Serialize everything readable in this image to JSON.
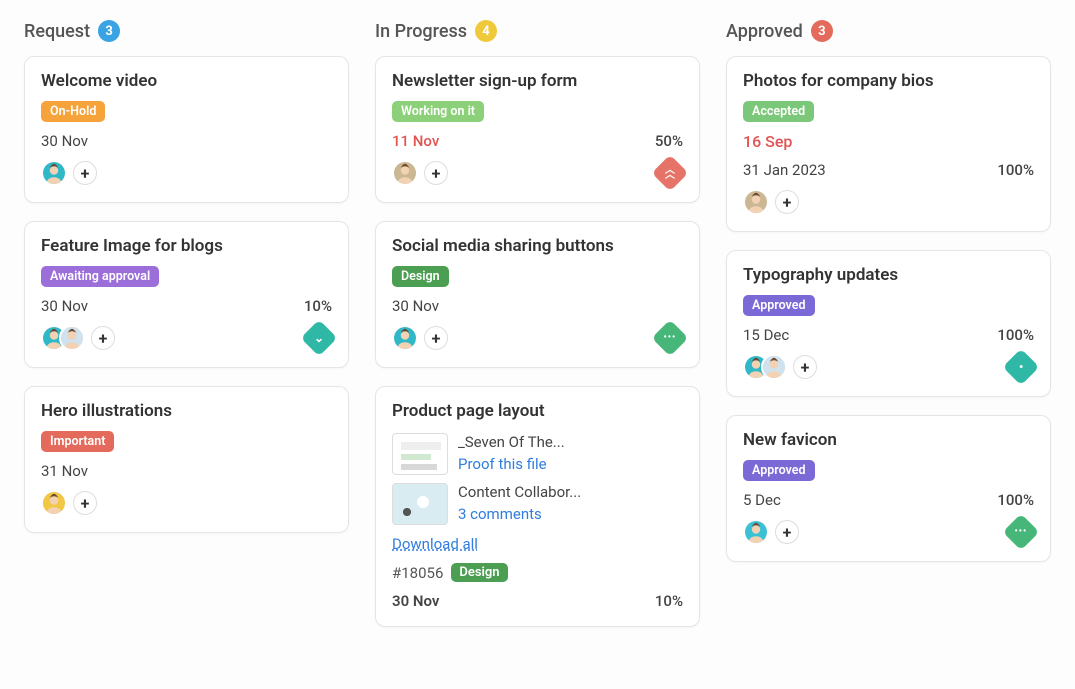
{
  "columns": [
    {
      "title": "Request",
      "count": "3",
      "count_color": "#3aa3e3",
      "badge_class": "badge-blue"
    },
    {
      "title": "In Progress",
      "count": "4",
      "count_color": "#f0c93a",
      "badge_class": "badge-yellow"
    },
    {
      "title": "Approved",
      "count": "3",
      "count_color": "#e46b5b",
      "badge_class": "badge-red"
    }
  ],
  "request_cards": [
    {
      "title": "Welcome video",
      "tag": {
        "label": "On-Hold",
        "color": "#f5a33a"
      },
      "date": "30 Nov",
      "avatars": [
        "teal-man"
      ]
    },
    {
      "title": "Feature Image for blogs",
      "tag": {
        "label": "Awaiting approval",
        "color": "#9b6ed9"
      },
      "date": "30 Nov",
      "percent": "10%",
      "avatars": [
        "teal-man",
        "light-man"
      ],
      "priority": {
        "color": "#2fb8a6",
        "glyph": "⌄"
      }
    },
    {
      "title": "Hero illustrations",
      "tag": {
        "label": "Important",
        "color": "#e46b5b"
      },
      "date": "31 Nov",
      "avatars": [
        "yellow-man"
      ]
    }
  ],
  "progress_cards": [
    {
      "title": "Newsletter sign-up form",
      "tag": {
        "label": "Working on it",
        "color": "#8dd07a"
      },
      "date": "11 Nov",
      "date_overdue": true,
      "percent": "50%",
      "avatars": [
        "sand-man"
      ],
      "priority": {
        "color": "#e57368",
        "glyph": "⋀"
      }
    },
    {
      "title": "Social media sharing buttons",
      "tag": {
        "label": "Design",
        "color": "#4b9e52"
      },
      "date": "30 Nov",
      "avatars": [
        "teal-man2"
      ],
      "priority": {
        "color": "#46b779",
        "glyph": "•••"
      }
    },
    {
      "title": "Product page layout",
      "attachments": [
        {
          "name": "_Seven Of The...",
          "link": "Proof this file"
        },
        {
          "name": "Content Collabor...",
          "link": "3 comments"
        }
      ],
      "download_all": "Download all",
      "task_id": "#18056",
      "tag_sm": {
        "label": "Design",
        "color": "#4b9e52"
      },
      "date": "30 Nov",
      "percent": "10%"
    }
  ],
  "approved_cards": [
    {
      "title": "Photos for company bios",
      "tag": {
        "label": "Accepted",
        "color": "#7cc87a"
      },
      "date_overdue_text": "16 Sep",
      "date": "31 Jan 2023",
      "percent": "100%",
      "avatars": [
        "sand-man"
      ]
    },
    {
      "title": "Typography updates",
      "tag": {
        "label": "Approved",
        "color": "#7b69d6"
      },
      "date": "15 Dec",
      "percent": "100%",
      "avatars": [
        "teal-man",
        "light-man"
      ],
      "priority": {
        "color": "#2fb8a6",
        "glyph": "•"
      }
    },
    {
      "title": "New favicon",
      "tag": {
        "label": "Approved",
        "color": "#7b69d6"
      },
      "date": "5 Dec",
      "percent": "100%",
      "avatars": [
        "teal-man3"
      ],
      "priority": {
        "color": "#46b779",
        "glyph": "•••"
      }
    }
  ]
}
